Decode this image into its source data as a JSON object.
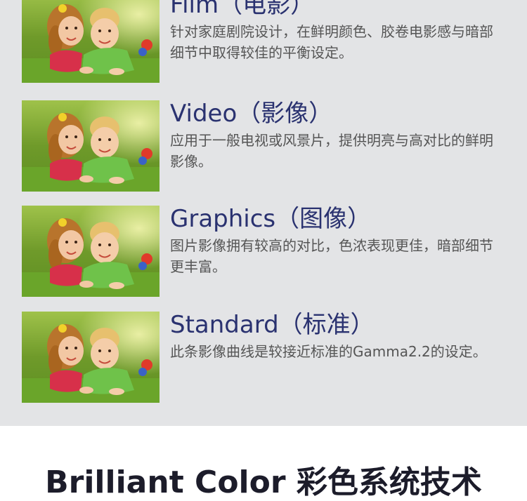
{
  "modes": [
    {
      "title": "Film（电影）",
      "desc": "针对家庭剧院设计，在鲜明颜色、胶卷电影感与暗部细节中取得较佳的平衡设定。"
    },
    {
      "title": "Video（影像）",
      "desc": "应用于一般电视或风景片，提供明亮与高对比的鲜明影像。"
    },
    {
      "title": "Graphics（图像）",
      "desc": "图片影像拥有较高的对比，色浓表现更佳，暗部细节更丰富。"
    },
    {
      "title": "Standard（标准）",
      "desc": "此条影像曲线是较接近标准的Gamma2.2的设定。"
    }
  ],
  "bottom_title": "Brilliant Color 彩色系统技术",
  "colors": {
    "panel": "#e3e4e6",
    "title": "#2a3270",
    "desc": "#555555"
  },
  "icons": [
    "children-photo"
  ]
}
